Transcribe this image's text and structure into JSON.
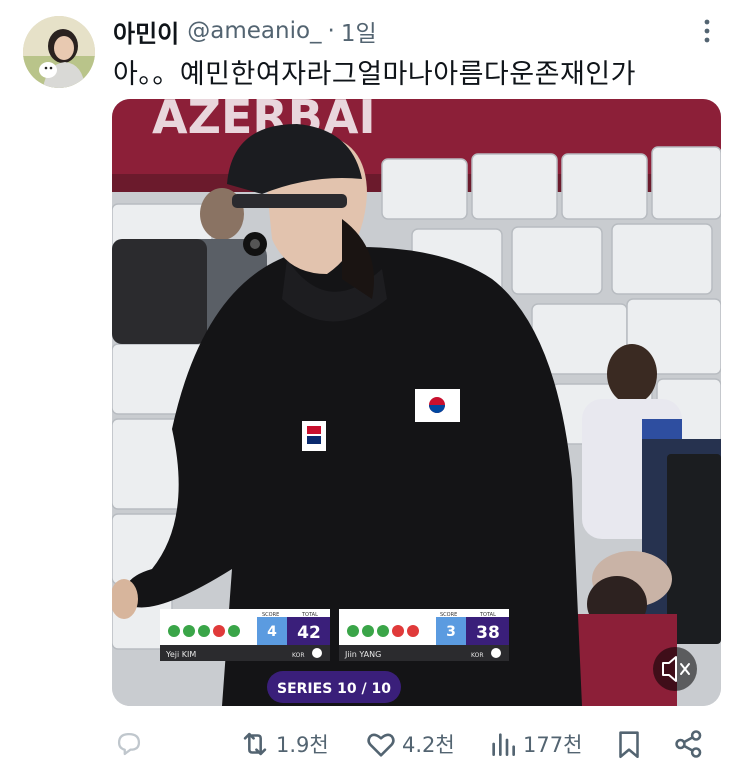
{
  "tweet": {
    "display_name": "아민이",
    "handle": "@ameanio_",
    "separator": "·",
    "time": "1일",
    "text": "아。。예민한여자라그얼마나아름다운존재인가"
  },
  "media": {
    "banner_text": "AZERBAI",
    "scoreboard": {
      "header_score": "SCORE",
      "header_total": "TOTAL",
      "left": {
        "player": "Yeji KIM",
        "country": "KOR",
        "sets": "4",
        "total": "42"
      },
      "right": {
        "player": "Jiin YANG",
        "country": "KOR",
        "sets": "3",
        "total": "38"
      },
      "series": "SERIES 10 / 10"
    },
    "mute_icon": "speaker-muted-icon"
  },
  "actions": {
    "reply": {
      "icon": "reply-icon",
      "count": ""
    },
    "retweet": {
      "icon": "retweet-icon",
      "count": "1.9천"
    },
    "like": {
      "icon": "heart-icon",
      "count": "4.2천"
    },
    "views": {
      "icon": "views-chart-icon",
      "count": "177천"
    },
    "bookmark": {
      "icon": "bookmark-icon"
    },
    "share": {
      "icon": "share-icon"
    }
  },
  "colors": {
    "text_primary": "#0f1419",
    "text_secondary": "#536471",
    "banner": "#8c1f38",
    "score_purple": "#3a1f7a",
    "score_blue": "#5b9be0"
  }
}
